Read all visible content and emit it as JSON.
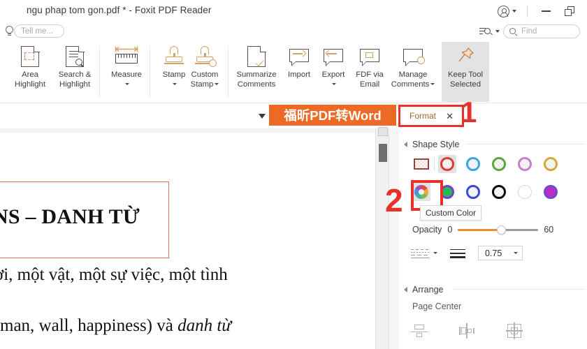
{
  "window": {
    "title": "ngu phap tom gon.pdf * - Foxit PDF Reader",
    "account_icon": "account-circle-icon",
    "account_caret": "chevron-down-icon",
    "minimize": "minimize-icon",
    "restore": "restore-icon"
  },
  "tellme": {
    "bulb_icon": "lightbulb-icon",
    "placeholder": "Tell me..."
  },
  "find": {
    "filter_icon": "search-options-icon",
    "caret": "chevron-down-icon",
    "search_icon": "search-icon",
    "placeholder": "Find"
  },
  "ribbon": {
    "items": [
      {
        "id": "area-highlight",
        "label_l1": "Area",
        "label_l2": "Highlight",
        "icon": "area-highlight-icon",
        "has_caret": false,
        "active": false
      },
      {
        "id": "search-highlight",
        "label_l1": "Search &",
        "label_l2": "Highlight",
        "icon": "search-highlight-icon",
        "has_caret": false,
        "active": false
      },
      {
        "id": "measure",
        "label_l1": "Measure",
        "label_l2": "",
        "icon": "measure-ruler-icon",
        "has_caret": true,
        "active": false
      },
      {
        "id": "stamp",
        "label_l1": "Stamp",
        "label_l2": "",
        "icon": "stamp-icon",
        "has_caret": true,
        "active": false
      },
      {
        "id": "custom-stamp",
        "label_l1": "Custom",
        "label_l2": "Stamp",
        "icon": "custom-stamp-icon",
        "has_caret": true,
        "active": false
      },
      {
        "id": "summarize-comments",
        "label_l1": "Summarize",
        "label_l2": "Comments",
        "icon": "summarize-comments-icon",
        "has_caret": false,
        "active": false
      },
      {
        "id": "import",
        "label_l1": "Import",
        "label_l2": "",
        "icon": "import-comments-icon",
        "has_caret": false,
        "active": false
      },
      {
        "id": "export",
        "label_l1": "Export",
        "label_l2": "",
        "icon": "export-comments-icon",
        "has_caret": true,
        "active": false
      },
      {
        "id": "fdf-via-email",
        "label_l1": "FDF via",
        "label_l2": "Email",
        "icon": "fdf-email-icon",
        "has_caret": false,
        "active": false
      },
      {
        "id": "manage-comments",
        "label_l1": "Manage",
        "label_l2": "Comments",
        "icon": "manage-comments-icon",
        "has_caret": true,
        "active": false
      },
      {
        "id": "keep-tool-selected",
        "label_l1": "Keep Tool",
        "label_l2": "Selected",
        "icon": "pushpin-icon",
        "has_caret": false,
        "active": true
      }
    ]
  },
  "banner": {
    "collapse_icon": "collapse-ribbon-icon",
    "ad_text": "福昕PDF转Word",
    "ad_color": "#ec6a26"
  },
  "format_tab": {
    "label": "Format",
    "close_icon": "close-icon"
  },
  "annotations": {
    "marker_1": "1",
    "marker_2": "2",
    "color": "#e8312a"
  },
  "document": {
    "title_line": "NS – DANH TỪ",
    "line_1": "ời, một vật, một sự việc, một tình",
    "line_2_pre": "man, wall, happiness) và ",
    "line_2_em": "danh từ",
    "selection_border": "#e0706a"
  },
  "panel": {
    "shape_style": {
      "section_title": "Shape Style",
      "collapse_icon": "triangle-collapse-icon",
      "row1": [
        {
          "id": "rect-swatch",
          "type": "rect",
          "stroke": "#8c4a3a",
          "selected": false
        },
        {
          "id": "red-ring",
          "type": "ring",
          "stroke": "#e03a32",
          "fill": "checker",
          "selected": true
        },
        {
          "id": "blue-ring",
          "type": "ring",
          "stroke": "#3aa8e0",
          "fill": "checker",
          "selected": false
        },
        {
          "id": "green-ring",
          "type": "ring",
          "stroke": "#5aa83a",
          "fill": "checker",
          "selected": false
        },
        {
          "id": "violet-ring",
          "type": "ring",
          "stroke": "#c97ec9",
          "fill": "checker",
          "selected": false
        },
        {
          "id": "gold-ring",
          "type": "ring",
          "stroke": "#d9a63a",
          "fill": "checker",
          "selected": false
        }
      ],
      "row2": [
        {
          "id": "custom-color",
          "type": "wheel",
          "selected": true
        },
        {
          "id": "purple-green-ring",
          "type": "ring",
          "stroke": "#7a3ec8",
          "fill": "#22bb55",
          "selected": false
        },
        {
          "id": "blue-ring-2",
          "type": "ring",
          "stroke": "#3a4ae0",
          "fill": "checker",
          "selected": false
        },
        {
          "id": "black-ring",
          "type": "ring",
          "stroke": "#0a0a0a",
          "fill": "checker",
          "selected": false
        },
        {
          "id": "white-ring",
          "type": "ring",
          "stroke": "#d8d8d8",
          "fill": "#ffffff",
          "selected": false
        },
        {
          "id": "magenta-ring",
          "type": "ring",
          "stroke": "#6a4ad0",
          "fill": "#c02bc0",
          "selected": false
        }
      ],
      "tooltip": "Custom Color",
      "opacity": {
        "label": "Opacity",
        "min": "0",
        "max": "60",
        "fill_color": "#e8922e",
        "percent": 54
      },
      "line": {
        "dash_icon": "dash-style-icon",
        "dash_caret": "chevron-down-icon",
        "weight_icon": "line-weight-icon",
        "weight_value": "0.75",
        "weight_caret": "chevron-down-icon"
      }
    },
    "arrange": {
      "section_title": "Arrange",
      "collapse_icon": "triangle-collapse-icon",
      "subtitle": "Page Center",
      "buttons": [
        {
          "id": "align-vertical-center",
          "icon": "align-vertical-center-icon"
        },
        {
          "id": "align-horizontal-center",
          "icon": "align-horizontal-center-icon"
        },
        {
          "id": "align-both-center",
          "icon": "align-both-center-icon"
        }
      ]
    }
  },
  "scrollbar": {
    "up_button": "scroll-up-button",
    "thumb": "scroll-thumb"
  }
}
